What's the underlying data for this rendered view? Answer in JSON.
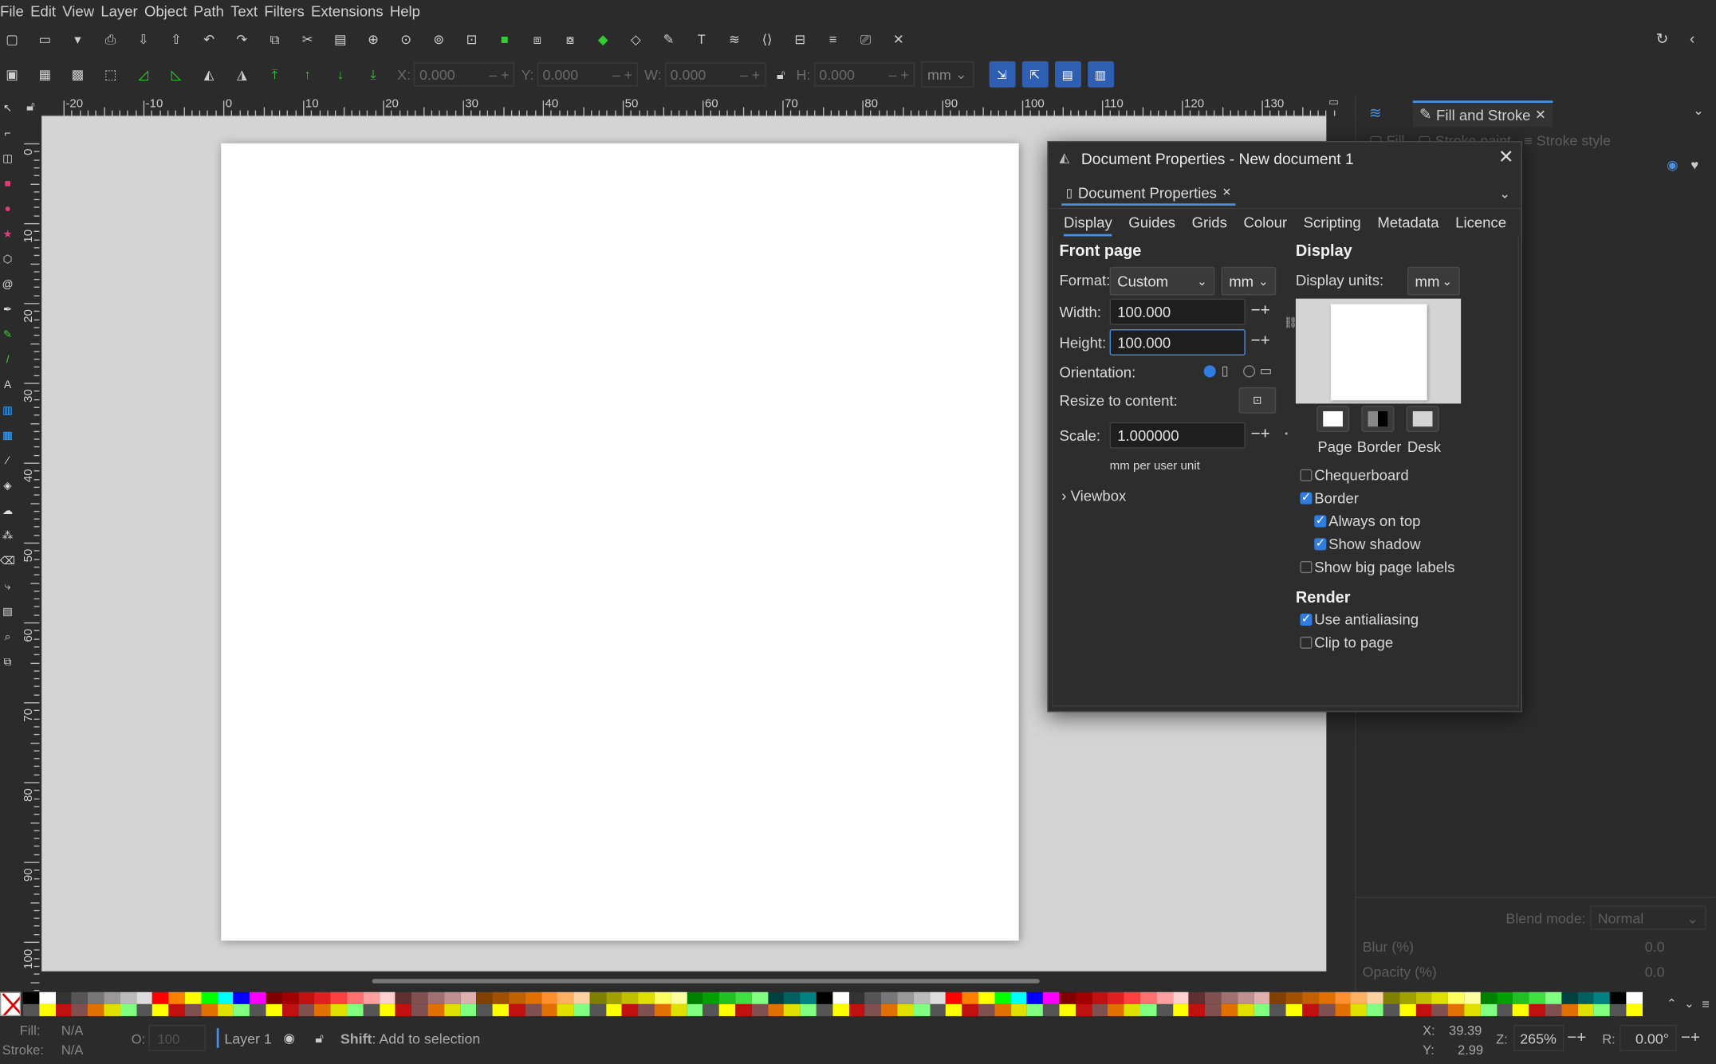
{
  "menubar": [
    "File",
    "Edit",
    "View",
    "Layer",
    "Object",
    "Path",
    "Text",
    "Filters",
    "Extensions",
    "Help"
  ],
  "toolbar2": {
    "x_label": "X:",
    "x_value": "0.000",
    "y_label": "Y:",
    "y_value": "0.000",
    "w_label": "W:",
    "w_value": "0.000",
    "h_label": "H:",
    "h_value": "0.000",
    "unit": "mm"
  },
  "ruler": {
    "h_labels": [
      "-20",
      "-10",
      "0",
      "10",
      "20",
      "30",
      "40",
      "50",
      "60",
      "70",
      "80",
      "90",
      "100",
      "110",
      "120",
      "130"
    ],
    "v_labels": [
      "0",
      "10",
      "20",
      "30",
      "40",
      "50",
      "60",
      "70",
      "80",
      "90",
      "100"
    ]
  },
  "dock": {
    "tab_label": "Fill and Stroke",
    "subtab_fill": "Fill",
    "subtab_stroke_paint": "Stroke paint",
    "subtab_stroke_style": "Stroke style",
    "blend_label": "Blend mode:",
    "blend_value": "Normal",
    "blur_label": "Blur (%)",
    "blur_value": "0.0",
    "opacity_label": "Opacity (%)",
    "opacity_value": "0.0"
  },
  "dialog": {
    "title": "Document Properties - New document 1",
    "panel_tab": "Document Properties",
    "tabs": [
      "Display",
      "Guides",
      "Grids",
      "Colour",
      "Scripting",
      "Metadata",
      "Licence"
    ],
    "front_page": "Front page",
    "format_label": "Format:",
    "format_value": "Custom",
    "format_unit": "mm",
    "width_label": "Width:",
    "width_value": "100.000",
    "height_label": "Height:",
    "height_value": "100.000",
    "orientation_label": "Orientation:",
    "resize_label": "Resize to content:",
    "scale_label": "Scale:",
    "scale_value": "1.000000",
    "scale_unit": "mm per user unit",
    "viewbox": "Viewbox",
    "display_heading": "Display",
    "display_units_label": "Display units:",
    "display_units_value": "mm",
    "swatch_page": "Page",
    "swatch_border": "Border",
    "swatch_desk": "Desk",
    "chequerboard": "Chequerboard",
    "border": "Border",
    "always_on_top": "Always on top",
    "show_shadow": "Show shadow",
    "big_labels": "Show big page labels",
    "render_heading": "Render",
    "antialiasing": "Use antialiasing",
    "clip_to_page": "Clip to page"
  },
  "status": {
    "fill_label": "Fill:",
    "fill_value": "N/A",
    "stroke_label": "Stroke:",
    "stroke_value": "N/A",
    "opacity_label": "O:",
    "opacity_value": "100",
    "layer": "Layer 1",
    "hint_key": "Shift",
    "hint_text": ": Add to selection",
    "x_label": "X:",
    "x_value": "39.39",
    "y_label": "Y:",
    "y_value": "2.99",
    "zoom_label": "Z:",
    "zoom_value": "265%",
    "rotate_label": "R:",
    "rotate_value": "0.00°"
  },
  "palette_colors": [
    "#000000",
    "#ffffff",
    "#333333",
    "#555555",
    "#777777",
    "#999999",
    "#bbbbbb",
    "#dddddd",
    "#ff0000",
    "#ff8000",
    "#ffff00",
    "#00ff00",
    "#00ffff",
    "#0000ff",
    "#ff00ff",
    "#800000",
    "#a00000",
    "#c01010",
    "#e02020",
    "#ff4040",
    "#ff7070",
    "#ffa0a0",
    "#ffd0d0",
    "#603030",
    "#805050",
    "#a07070",
    "#c09090",
    "#e0b0b0",
    "#804000",
    "#a05000",
    "#c06000",
    "#e07000",
    "#ff9030",
    "#ffb060",
    "#ffd0a0",
    "#808000",
    "#a0a000",
    "#c0c000",
    "#e0e000",
    "#ffff60",
    "#ffffa0",
    "#008000",
    "#00a000",
    "#20c020",
    "#40e040",
    "#80ff80",
    "#004040",
    "#006060",
    "#008080"
  ]
}
